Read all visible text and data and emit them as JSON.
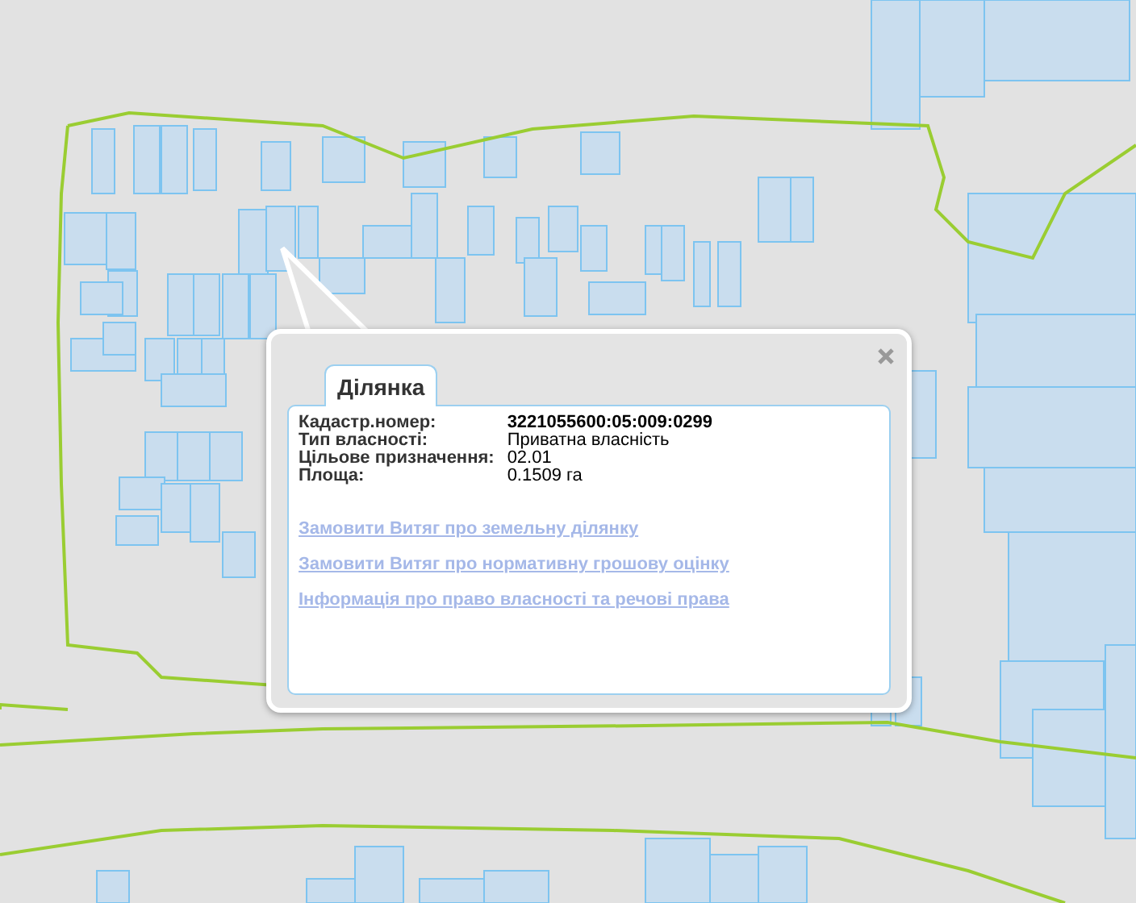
{
  "popup": {
    "tab": {
      "label": "Ділянка",
      "selected": true
    },
    "fields": [
      {
        "label": "Кадастр.номер:",
        "value": "3221055600:05:009:0299",
        "bold": true
      },
      {
        "label": "Тип власності:",
        "value": "Приватна власність",
        "bold": false
      },
      {
        "label": "Цільове призначення:",
        "value": "02.01",
        "bold": false
      },
      {
        "label": "Площа:",
        "value": "0.1509 га",
        "bold": false
      }
    ],
    "links": [
      "Замовити Витяг про земельну ділянку",
      "Замовити Витяг про нормативну грошову оцінку",
      "Інформація про право власності та речові права"
    ]
  }
}
